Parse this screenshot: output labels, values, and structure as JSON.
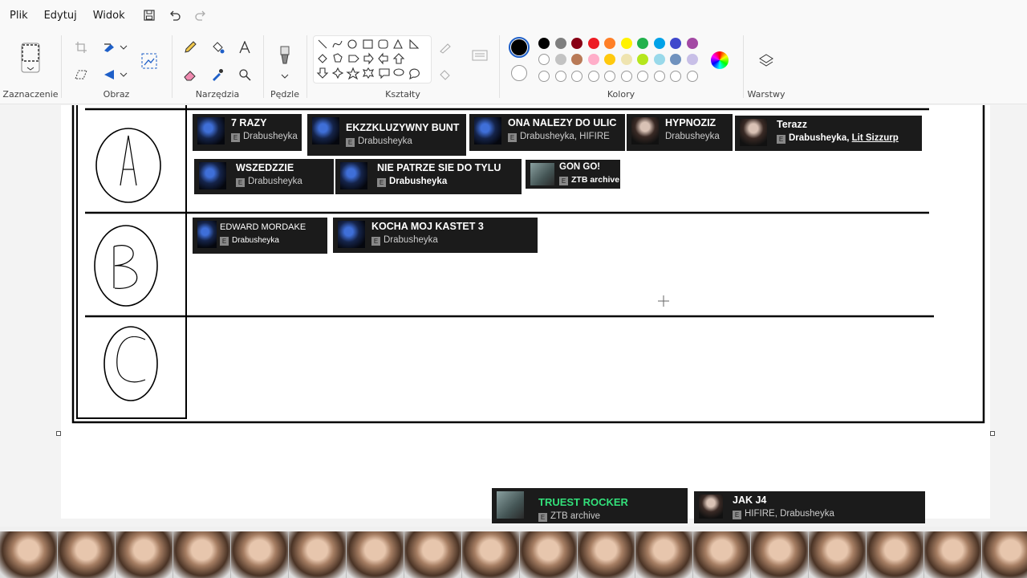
{
  "menu": {
    "items": [
      "Plik",
      "Edytuj",
      "Widok"
    ]
  },
  "ribbon": {
    "groups": {
      "selection": "Zaznaczenie",
      "image": "Obraz",
      "tools": "Narzędzia",
      "brushes": "Pędzle",
      "shapes": "Kształty",
      "colors": "Kolory",
      "layers": "Warstwy"
    },
    "palette_row1": [
      "#000000",
      "#7f7f7f",
      "#880015",
      "#ed1c24",
      "#ff7f27",
      "#fff200",
      "#22b14c",
      "#00a2e8",
      "#3f48cc",
      "#a349a4"
    ],
    "palette_row2": [
      "#ffffff",
      "#c3c3c3",
      "#b97a57",
      "#ffaec9",
      "#ffc90e",
      "#efe4b0",
      "#b5e61d",
      "#99d9ea",
      "#7092be",
      "#c8bfe7"
    ],
    "active_color": "#000000",
    "secondary_color": "#ffffff"
  },
  "tiers": {
    "a": "A",
    "b": "B",
    "c": "C"
  },
  "songs": [
    {
      "title": "7 RAZY",
      "artist": "Drabusheyka",
      "thumb": "blue"
    },
    {
      "title": "EKZZKLUZYWNY BUNT",
      "artist": "Drabusheyka",
      "thumb": "blue"
    },
    {
      "title": "ONA NALEZY DO ULIC",
      "artist": "Drabusheyka, HIFIRE",
      "thumb": "blue"
    },
    {
      "title": "HYPNOZIZ",
      "artist": "Drabusheyka",
      "thumb": "face"
    },
    {
      "title": "Terazz",
      "artist_a": "Drabusheyka",
      "artist_sep": ", ",
      "artist_b": "Lit Sizzurp",
      "thumb": "face"
    },
    {
      "title": "WSZEDZZIE",
      "artist": "Drabusheyka",
      "thumb": "blue"
    },
    {
      "title": "NIE PATRZE SIE DO TYLU",
      "artist": "Drabusheyka",
      "thumb": "blue"
    },
    {
      "title": "GON GO!",
      "artist": "ZTB archive",
      "thumb": "grey"
    },
    {
      "title": "EDWARD MORDAKE",
      "artist": "Drabusheyka",
      "thumb": "blue"
    },
    {
      "title": "KOCHA MOJ KASTET 3",
      "artist": "Drabusheyka",
      "thumb": "blue"
    },
    {
      "title": "TRUEST ROCKER",
      "artist": "ZTB archive",
      "thumb": "grey",
      "title_color": "#33e07a"
    },
    {
      "title": "JAK J4",
      "artist": "HIFIRE, Drabusheyka",
      "thumb": "face"
    }
  ]
}
